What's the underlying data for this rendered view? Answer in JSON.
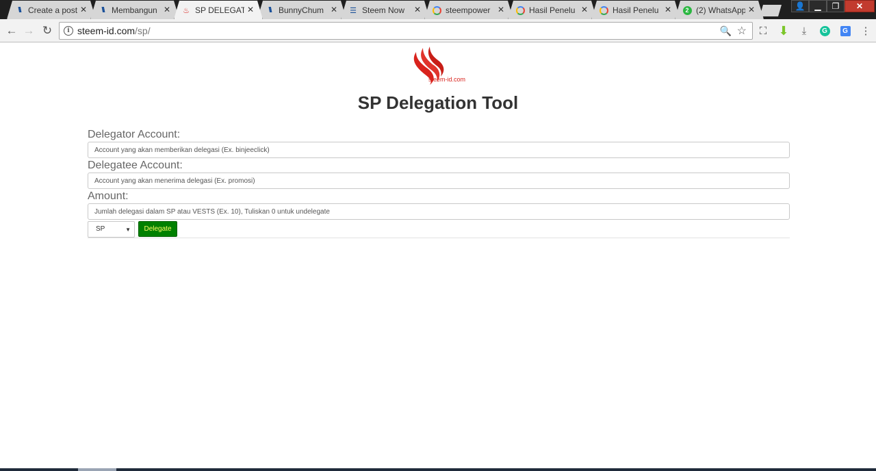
{
  "tabs": [
    {
      "title": "Create a post",
      "icon": "steemit-icon"
    },
    {
      "title": "Membangun",
      "icon": "steemit-icon"
    },
    {
      "title": "SP DELEGATI",
      "icon": "steem-id-flame-icon"
    },
    {
      "title": "BunnyChum",
      "icon": "steemit-icon"
    },
    {
      "title": "Steem Now",
      "icon": "steem-now-icon"
    },
    {
      "title": "steempower",
      "icon": "google-icon"
    },
    {
      "title": "Hasil Penelu",
      "icon": "google-icon"
    },
    {
      "title": "Hasil Penelu",
      "icon": "google-icon"
    },
    {
      "title": "(2) WhatsApp",
      "icon": "whatsapp-icon",
      "badge": "2"
    }
  ],
  "active_tab": 2,
  "address_bar": {
    "host": "steem-id.com",
    "path": "/sp/"
  },
  "page": {
    "logo_text": "steem-id.com",
    "title": "SP Delegation Tool",
    "fields": [
      {
        "label": "Delegator Account:",
        "placeholder": "Account yang akan memberikan delegasi (Ex. binjeeclick)"
      },
      {
        "label": "Delegatee Account:",
        "placeholder": "Account yang akan menerima delegasi (Ex. promosi)"
      },
      {
        "label": "Amount:",
        "placeholder": "Jumlah delegasi dalam SP atau VESTS (Ex. 10), Tuliskan 0 untuk undelegate"
      }
    ],
    "unit_select": {
      "selected": "SP"
    },
    "delegate_button": "Delegate"
  },
  "colors": {
    "logo_red": "#d9231d",
    "button_green": "#008000",
    "button_text": "#ffff66"
  }
}
